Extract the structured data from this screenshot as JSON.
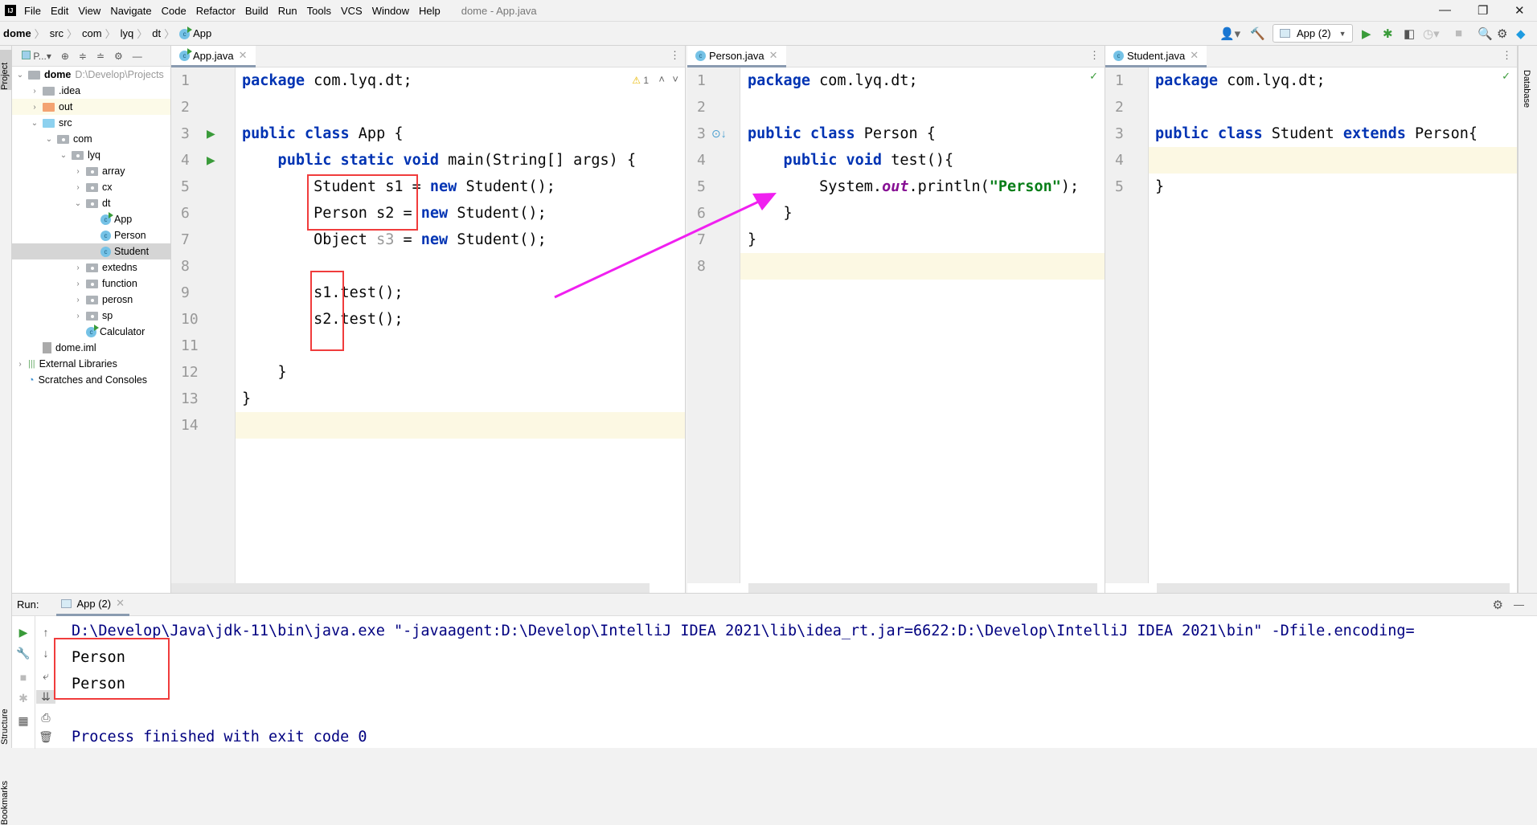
{
  "menu": {
    "items": [
      "File",
      "Edit",
      "View",
      "Navigate",
      "Code",
      "Refactor",
      "Build",
      "Run",
      "Tools",
      "VCS",
      "Window",
      "Help"
    ],
    "window_title": "dome - App.java"
  },
  "breadcrumb": [
    "dome",
    "src",
    "com",
    "lyq",
    "dt",
    "App"
  ],
  "toolbar": {
    "run_config": "App (2)"
  },
  "side_labels": {
    "project": "Project",
    "structure": "Structure",
    "bookmarks": "Bookmarks",
    "database": "Database"
  },
  "project": {
    "header": "P...",
    "tree": [
      {
        "label": "dome",
        "hint": "D:\\Develop\\Projects",
        "depth": 0,
        "expand": "open",
        "icon": "module"
      },
      {
        "label": ".idea",
        "depth": 1,
        "expand": "closed",
        "icon": "folder"
      },
      {
        "label": "out",
        "depth": 1,
        "expand": "closed",
        "icon": "folder-orange"
      },
      {
        "label": "src",
        "depth": 1,
        "expand": "open",
        "icon": "folder-blue"
      },
      {
        "label": "com",
        "depth": 2,
        "expand": "open",
        "icon": "package"
      },
      {
        "label": "lyq",
        "depth": 3,
        "expand": "open",
        "icon": "package"
      },
      {
        "label": "array",
        "depth": 4,
        "expand": "closed",
        "icon": "package"
      },
      {
        "label": "cx",
        "depth": 4,
        "expand": "closed",
        "icon": "package"
      },
      {
        "label": "dt",
        "depth": 4,
        "expand": "open",
        "icon": "package"
      },
      {
        "label": "App",
        "depth": 5,
        "expand": "none",
        "icon": "class-run"
      },
      {
        "label": "Person",
        "depth": 5,
        "expand": "none",
        "icon": "class"
      },
      {
        "label": "Student",
        "depth": 5,
        "expand": "none",
        "icon": "class",
        "selected": true
      },
      {
        "label": "extedns",
        "depth": 4,
        "expand": "closed",
        "icon": "package"
      },
      {
        "label": "function",
        "depth": 4,
        "expand": "closed",
        "icon": "package"
      },
      {
        "label": "perosn",
        "depth": 4,
        "expand": "closed",
        "icon": "package"
      },
      {
        "label": "sp",
        "depth": 4,
        "expand": "closed",
        "icon": "package"
      },
      {
        "label": "Calculator",
        "depth": 4,
        "expand": "none",
        "icon": "class-run"
      },
      {
        "label": "dome.iml",
        "depth": 1,
        "expand": "none",
        "icon": "file"
      },
      {
        "label": "External Libraries",
        "depth": 0,
        "expand": "closed",
        "icon": "library"
      },
      {
        "label": "Scratches and Consoles",
        "depth": 0,
        "expand": "none",
        "icon": "scratch"
      }
    ]
  },
  "editors": [
    {
      "tab": "App.java",
      "warning_count": "1",
      "current_line": 14,
      "lines": [
        [
          [
            "package",
            "kw"
          ],
          [
            " com.lyq.dt;",
            ""
          ]
        ],
        [],
        [
          [
            "public class",
            "kw"
          ],
          [
            " App {",
            ""
          ]
        ],
        [
          [
            "    public static void",
            "kw"
          ],
          [
            " main(String[] args) {",
            ""
          ]
        ],
        [
          [
            "        Student s1 = ",
            ""
          ],
          [
            "new",
            "kw"
          ],
          [
            " Student();",
            ""
          ]
        ],
        [
          [
            "        Person s2 = ",
            ""
          ],
          [
            "new",
            "kw"
          ],
          [
            " Student();",
            ""
          ]
        ],
        [
          [
            "        Object ",
            ""
          ],
          [
            "s3",
            "unused"
          ],
          [
            " = ",
            ""
          ],
          [
            "new",
            "kw"
          ],
          [
            " Student();",
            ""
          ]
        ],
        [],
        [
          [
            "        s1.test();",
            ""
          ]
        ],
        [
          [
            "        s2.test();",
            ""
          ]
        ],
        [],
        [
          [
            "    }",
            ""
          ]
        ],
        [
          [
            "}",
            ""
          ]
        ],
        []
      ]
    },
    {
      "tab": "Person.java",
      "current_line": 8,
      "lines": [
        [
          [
            "package",
            "kw"
          ],
          [
            " com.lyq.dt;",
            ""
          ]
        ],
        [],
        [
          [
            "public class",
            "kw"
          ],
          [
            " Person {",
            ""
          ]
        ],
        [
          [
            "    public void",
            "kw"
          ],
          [
            " test(){",
            ""
          ]
        ],
        [
          [
            "        System.",
            ""
          ],
          [
            "out",
            "fld"
          ],
          [
            ".println(",
            ""
          ],
          [
            "\"Person\"",
            "str"
          ],
          [
            ");",
            ""
          ]
        ],
        [
          [
            "    }",
            ""
          ]
        ],
        [
          [
            "}",
            ""
          ]
        ],
        []
      ]
    },
    {
      "tab": "Student.java",
      "current_line": 4,
      "lines": [
        [
          [
            "package",
            "kw"
          ],
          [
            " com.lyq.dt;",
            ""
          ]
        ],
        [],
        [
          [
            "public class",
            "kw"
          ],
          [
            " Student ",
            ""
          ],
          [
            "extends",
            "kw"
          ],
          [
            " Person{",
            ""
          ]
        ],
        [],
        [
          [
            "}",
            ""
          ]
        ]
      ]
    }
  ],
  "run": {
    "label": "Run:",
    "tab": "App (2)",
    "console": [
      {
        "text": "D:\\Develop\\Java\\jdk-11\\bin\\java.exe \"-javaagent:D:\\Develop\\IntelliJ IDEA 2021\\lib\\idea_rt.jar=6622:D:\\Develop\\IntelliJ IDEA 2021\\bin\" -Dfile.encoding=",
        "cls": "blue"
      },
      {
        "text": "Person",
        "cls": ""
      },
      {
        "text": "Person",
        "cls": ""
      },
      {
        "text": "",
        "cls": ""
      },
      {
        "text": "Process finished with exit code 0",
        "cls": "blue"
      }
    ]
  },
  "colors": {
    "annotation_red": "#f03c3c",
    "arrow_magenta": "#f020f0",
    "keyword": "#0033b3",
    "string": "#067d17"
  }
}
